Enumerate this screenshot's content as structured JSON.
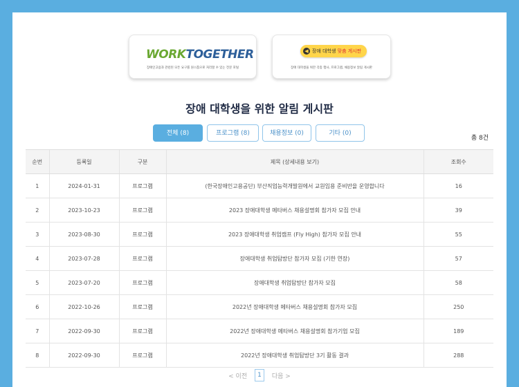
{
  "banners": {
    "work_together": {
      "logo_word1": "WORK",
      "logo_word2": "TOGETHER",
      "caption": "장애인고용과 관련된 모든 요구를 원스톱으로 처리할 수 있는 전문 포털"
    },
    "info": {
      "badge_prefix": "장애 대학생",
      "badge_highlight": "맞춤 게시판",
      "caption": "장애 대학생을 위한 각종 행사, 프로그램, 채용정보 알림 게시판"
    }
  },
  "board": {
    "title": "장애 대학생을 위한 알림 게시판",
    "total": "총 8건",
    "tabs": [
      {
        "label": "전체 (8)",
        "active": true
      },
      {
        "label": "프로그램 (8)",
        "active": false
      },
      {
        "label": "채용정보 (0)",
        "active": false
      },
      {
        "label": "기타 (0)",
        "active": false
      }
    ],
    "columns": [
      "순번",
      "등록일",
      "구분",
      "제목 (상세내용 보기)",
      "조회수"
    ],
    "rows": [
      {
        "no": "1",
        "date": "2024-01-31",
        "category": "프로그램",
        "title": "(한국장애인고용공단) 부산직업능력개발원에서 교원임용 준비반을 운영합니다",
        "views": "16"
      },
      {
        "no": "2",
        "date": "2023-10-23",
        "category": "프로그램",
        "title": "2023 장애대학생 메타버스 채용설명회 참가자 모집 안내",
        "views": "39"
      },
      {
        "no": "3",
        "date": "2023-08-30",
        "category": "프로그램",
        "title": "2023 장애대학생 취업캠프 (Fly High) 참가자 모집 안내",
        "views": "55"
      },
      {
        "no": "4",
        "date": "2023-07-28",
        "category": "프로그램",
        "title": "장애대학생 취업탐방단 참가자 모집 (기한 연장)",
        "views": "57"
      },
      {
        "no": "5",
        "date": "2023-07-20",
        "category": "프로그램",
        "title": "장애대학생 취업탐방단 참가자 모집",
        "views": "58"
      },
      {
        "no": "6",
        "date": "2022-10-26",
        "category": "프로그램",
        "title": "2022년 장애대학생 메타버스 채용설명회 참가자 모집",
        "views": "250"
      },
      {
        "no": "7",
        "date": "2022-09-30",
        "category": "프로그램",
        "title": "2022년 장애대학생 메타버스 채용설명회 참가기업 모집",
        "views": "189"
      },
      {
        "no": "8",
        "date": "2022-09-30",
        "category": "프로그램",
        "title": "2022년 장애대학생 취업탐방단 3기 활동 결과",
        "views": "288"
      }
    ]
  },
  "pagination": {
    "prev": "< 이전",
    "current": "1",
    "next": "다음 >"
  }
}
